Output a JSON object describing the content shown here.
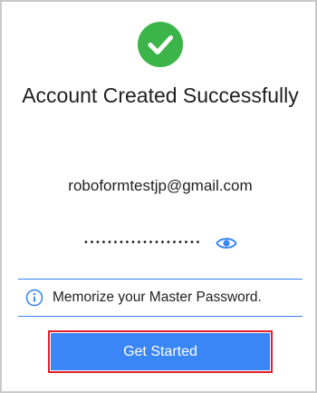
{
  "header": {
    "status_icon": "check-circle-icon",
    "status_color": "#3bb54a",
    "title": "Account Created Successfully"
  },
  "account": {
    "email": "roboformtestjp@gmail.com",
    "password_masked": "••••••••••••••••••••",
    "reveal_icon": "eye-icon"
  },
  "info": {
    "icon": "info-icon",
    "message": "Memorize your Master Password."
  },
  "actions": {
    "get_started_label": "Get Started",
    "accent_color": "#3a86f6",
    "highlight_color": "#e0202a"
  }
}
